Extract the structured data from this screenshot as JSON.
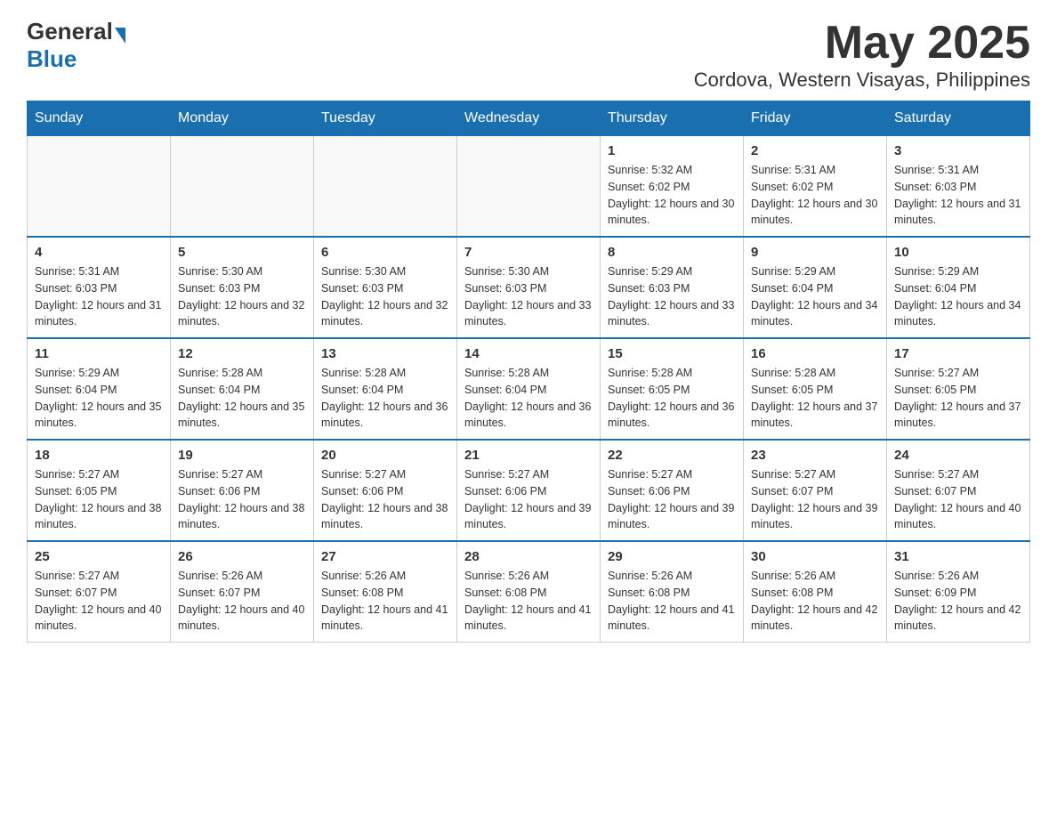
{
  "header": {
    "logo_general": "General",
    "logo_blue": "Blue",
    "month_year": "May 2025",
    "location": "Cordova, Western Visayas, Philippines"
  },
  "days_of_week": [
    "Sunday",
    "Monday",
    "Tuesday",
    "Wednesday",
    "Thursday",
    "Friday",
    "Saturday"
  ],
  "weeks": [
    {
      "days": [
        {
          "number": "",
          "info": ""
        },
        {
          "number": "",
          "info": ""
        },
        {
          "number": "",
          "info": ""
        },
        {
          "number": "",
          "info": ""
        },
        {
          "number": "1",
          "info": "Sunrise: 5:32 AM\nSunset: 6:02 PM\nDaylight: 12 hours and 30 minutes."
        },
        {
          "number": "2",
          "info": "Sunrise: 5:31 AM\nSunset: 6:02 PM\nDaylight: 12 hours and 30 minutes."
        },
        {
          "number": "3",
          "info": "Sunrise: 5:31 AM\nSunset: 6:03 PM\nDaylight: 12 hours and 31 minutes."
        }
      ]
    },
    {
      "days": [
        {
          "number": "4",
          "info": "Sunrise: 5:31 AM\nSunset: 6:03 PM\nDaylight: 12 hours and 31 minutes."
        },
        {
          "number": "5",
          "info": "Sunrise: 5:30 AM\nSunset: 6:03 PM\nDaylight: 12 hours and 32 minutes."
        },
        {
          "number": "6",
          "info": "Sunrise: 5:30 AM\nSunset: 6:03 PM\nDaylight: 12 hours and 32 minutes."
        },
        {
          "number": "7",
          "info": "Sunrise: 5:30 AM\nSunset: 6:03 PM\nDaylight: 12 hours and 33 minutes."
        },
        {
          "number": "8",
          "info": "Sunrise: 5:29 AM\nSunset: 6:03 PM\nDaylight: 12 hours and 33 minutes."
        },
        {
          "number": "9",
          "info": "Sunrise: 5:29 AM\nSunset: 6:04 PM\nDaylight: 12 hours and 34 minutes."
        },
        {
          "number": "10",
          "info": "Sunrise: 5:29 AM\nSunset: 6:04 PM\nDaylight: 12 hours and 34 minutes."
        }
      ]
    },
    {
      "days": [
        {
          "number": "11",
          "info": "Sunrise: 5:29 AM\nSunset: 6:04 PM\nDaylight: 12 hours and 35 minutes."
        },
        {
          "number": "12",
          "info": "Sunrise: 5:28 AM\nSunset: 6:04 PM\nDaylight: 12 hours and 35 minutes."
        },
        {
          "number": "13",
          "info": "Sunrise: 5:28 AM\nSunset: 6:04 PM\nDaylight: 12 hours and 36 minutes."
        },
        {
          "number": "14",
          "info": "Sunrise: 5:28 AM\nSunset: 6:04 PM\nDaylight: 12 hours and 36 minutes."
        },
        {
          "number": "15",
          "info": "Sunrise: 5:28 AM\nSunset: 6:05 PM\nDaylight: 12 hours and 36 minutes."
        },
        {
          "number": "16",
          "info": "Sunrise: 5:28 AM\nSunset: 6:05 PM\nDaylight: 12 hours and 37 minutes."
        },
        {
          "number": "17",
          "info": "Sunrise: 5:27 AM\nSunset: 6:05 PM\nDaylight: 12 hours and 37 minutes."
        }
      ]
    },
    {
      "days": [
        {
          "number": "18",
          "info": "Sunrise: 5:27 AM\nSunset: 6:05 PM\nDaylight: 12 hours and 38 minutes."
        },
        {
          "number": "19",
          "info": "Sunrise: 5:27 AM\nSunset: 6:06 PM\nDaylight: 12 hours and 38 minutes."
        },
        {
          "number": "20",
          "info": "Sunrise: 5:27 AM\nSunset: 6:06 PM\nDaylight: 12 hours and 38 minutes."
        },
        {
          "number": "21",
          "info": "Sunrise: 5:27 AM\nSunset: 6:06 PM\nDaylight: 12 hours and 39 minutes."
        },
        {
          "number": "22",
          "info": "Sunrise: 5:27 AM\nSunset: 6:06 PM\nDaylight: 12 hours and 39 minutes."
        },
        {
          "number": "23",
          "info": "Sunrise: 5:27 AM\nSunset: 6:07 PM\nDaylight: 12 hours and 39 minutes."
        },
        {
          "number": "24",
          "info": "Sunrise: 5:27 AM\nSunset: 6:07 PM\nDaylight: 12 hours and 40 minutes."
        }
      ]
    },
    {
      "days": [
        {
          "number": "25",
          "info": "Sunrise: 5:27 AM\nSunset: 6:07 PM\nDaylight: 12 hours and 40 minutes."
        },
        {
          "number": "26",
          "info": "Sunrise: 5:26 AM\nSunset: 6:07 PM\nDaylight: 12 hours and 40 minutes."
        },
        {
          "number": "27",
          "info": "Sunrise: 5:26 AM\nSunset: 6:08 PM\nDaylight: 12 hours and 41 minutes."
        },
        {
          "number": "28",
          "info": "Sunrise: 5:26 AM\nSunset: 6:08 PM\nDaylight: 12 hours and 41 minutes."
        },
        {
          "number": "29",
          "info": "Sunrise: 5:26 AM\nSunset: 6:08 PM\nDaylight: 12 hours and 41 minutes."
        },
        {
          "number": "30",
          "info": "Sunrise: 5:26 AM\nSunset: 6:08 PM\nDaylight: 12 hours and 42 minutes."
        },
        {
          "number": "31",
          "info": "Sunrise: 5:26 AM\nSunset: 6:09 PM\nDaylight: 12 hours and 42 minutes."
        }
      ]
    }
  ]
}
